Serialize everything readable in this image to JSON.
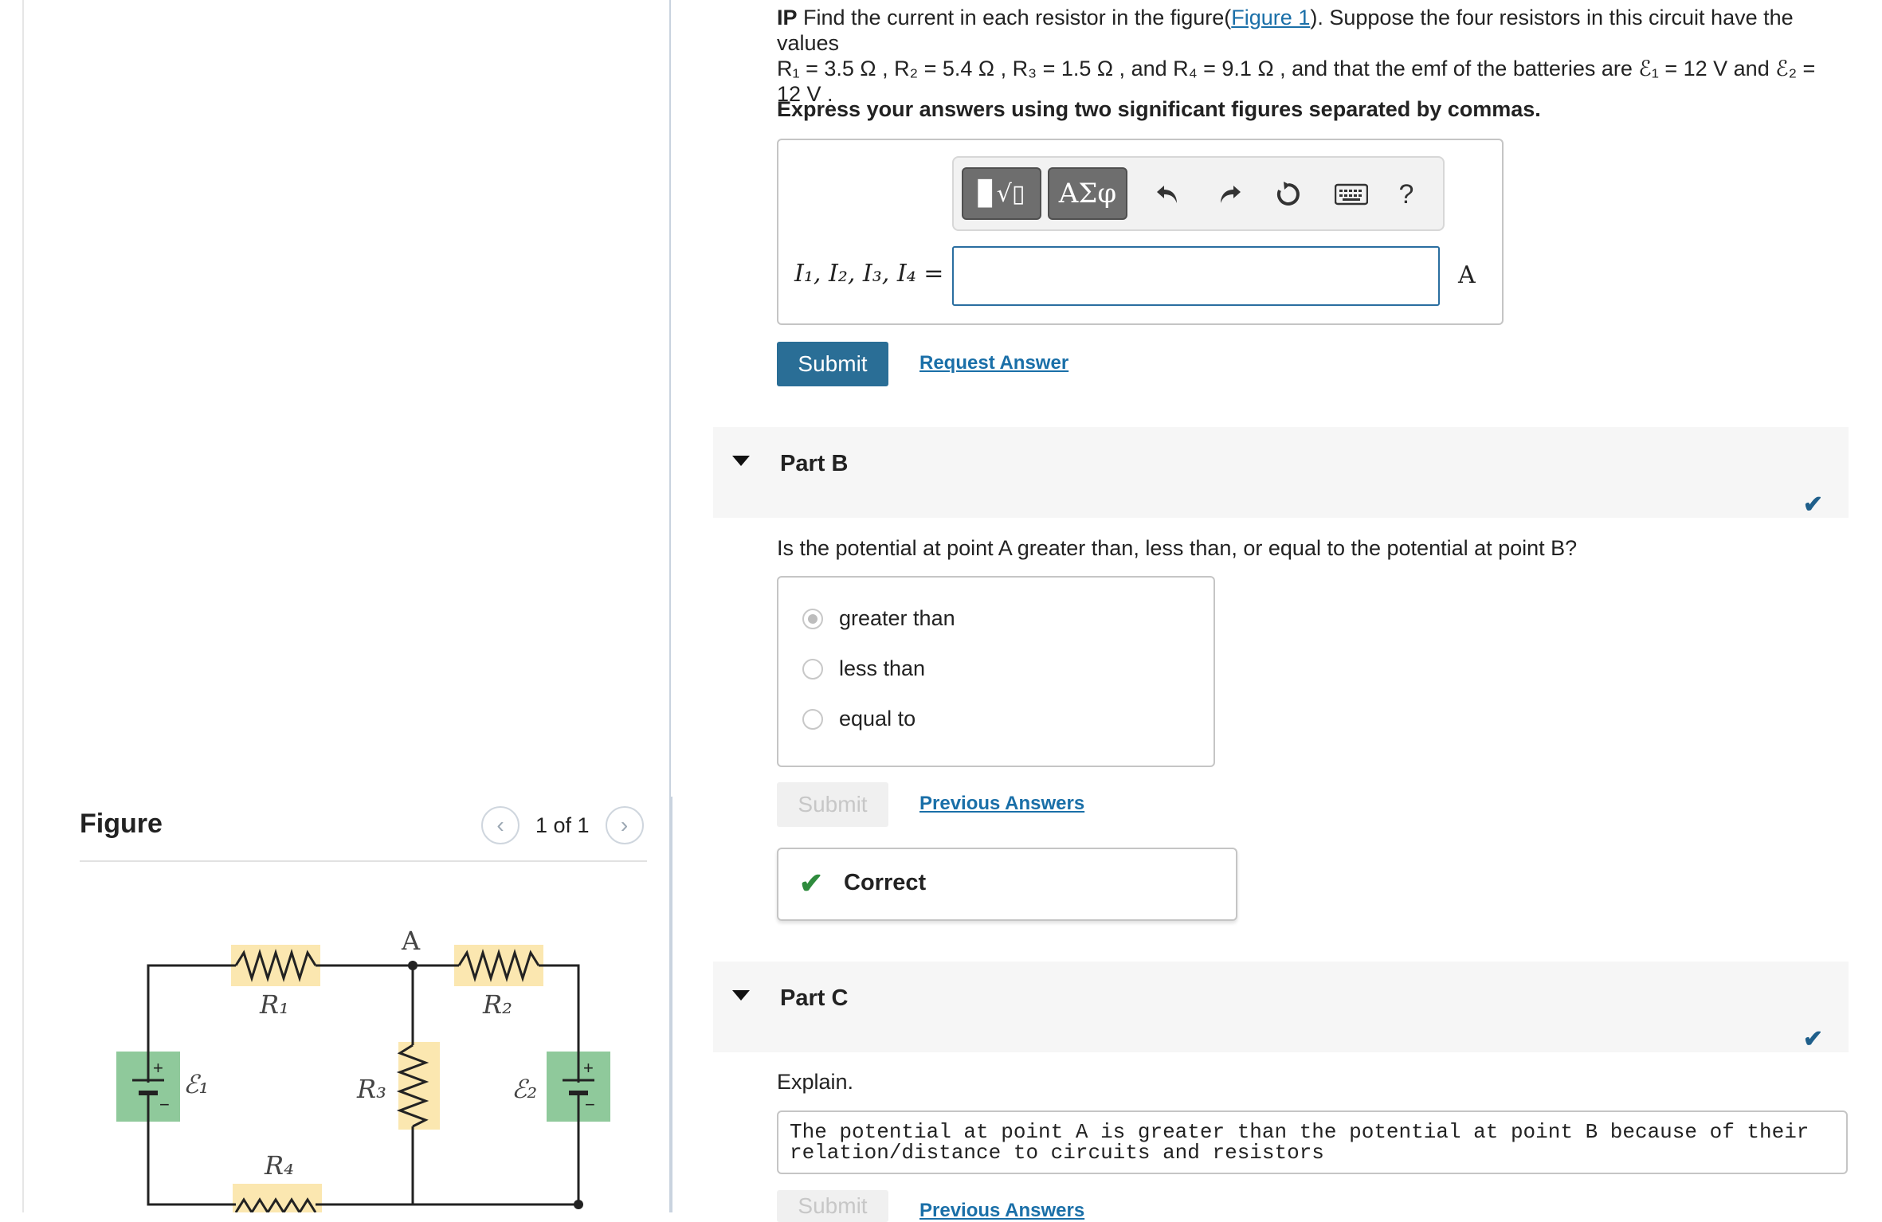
{
  "problem": {
    "prefix": "IP",
    "text_before_link": " Find the current in each resistor in the figure(",
    "figure_link": "Figure 1",
    "text_after_link": "). Suppose the four resistors in this circuit have the values",
    "line2": "R₁ = 3.5 Ω , R₂ = 5.4 Ω , R₃ = 1.5 Ω , and R₄ = 9.1 Ω , and that the emf of the batteries are ℰ₁ = 12 V and ℰ₂ =",
    "line3": "12 V ."
  },
  "instruction": "Express your answers using two significant figures separated by commas.",
  "toolbar": {
    "templates_label": "▊√▯",
    "greek_label": "ΑΣφ",
    "undo_icon": "undo-icon",
    "redo_icon": "redo-icon",
    "reset_icon": "reset-icon",
    "keyboard_icon": "keyboard-icon",
    "help_label": "?"
  },
  "part_a": {
    "answer_label": "I₁, I₂, I₃, I₄ =",
    "answer_value": "",
    "unit": "A",
    "submit_label": "Submit",
    "request_answer_label": "Request Answer"
  },
  "part_b": {
    "title": "Part B",
    "question": "Is the potential at point A greater than, less than, or equal to the potential at point B?",
    "choices": [
      "greater than",
      "less than",
      "equal to"
    ],
    "selected_index": 0,
    "submit_label": "Submit",
    "previous_answers_label": "Previous Answers",
    "result_label": "Correct"
  },
  "part_c": {
    "title": "Part C",
    "question": "Explain.",
    "answer_line1": "The potential at point A is greater than the potential at point B because of their",
    "answer_line2": "relation/distance to circuits and resistors",
    "submit_label": "Submit",
    "previous_answers_label": "Previous Answers"
  },
  "figure_panel": {
    "title": "Figure",
    "pager": "1 of 1",
    "labels": {
      "r1": "R₁",
      "r2": "R₂",
      "r3": "R₃",
      "r4": "R₄",
      "e1": "ℰ₁",
      "e2": "ℰ₂",
      "a": "A",
      "plus": "+",
      "minus": "−"
    }
  },
  "colors": {
    "accent": "#2a6e96",
    "link": "#1a6fa8",
    "correct": "#2e8b3d",
    "resistor_highlight": "#fbe7b0",
    "battery_highlight": "#8fc99b"
  }
}
